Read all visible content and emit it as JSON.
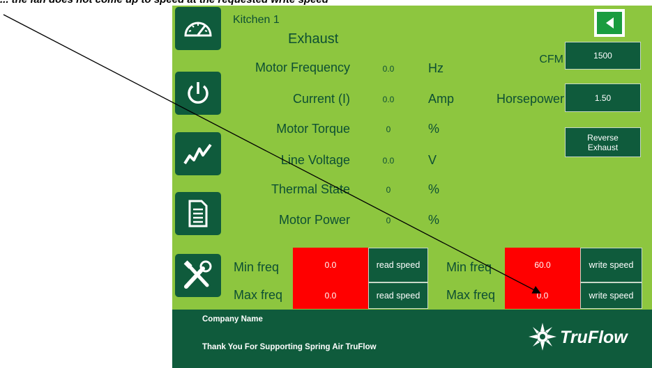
{
  "caption": "... the fan does not come up to speed at the requested write speed",
  "header": {
    "location": "Kitchen 1",
    "fan_type": "Exhaust"
  },
  "nav": [
    {
      "name": "dashboard",
      "icon": "speedometer-icon"
    },
    {
      "name": "power",
      "icon": "power-icon"
    },
    {
      "name": "trend",
      "icon": "trend-chart-icon"
    },
    {
      "name": "report",
      "icon": "document-icon"
    },
    {
      "name": "tools",
      "icon": "tools-icon"
    }
  ],
  "readings": [
    {
      "label": "Motor Frequency",
      "value": "0.0",
      "unit": "Hz"
    },
    {
      "label": "Current (I)",
      "value": "0.0",
      "unit": "Amp"
    },
    {
      "label": "Motor Torque",
      "value": "0",
      "unit": "%"
    },
    {
      "label": "Line Voltage",
      "value": "0.0",
      "unit": "V"
    },
    {
      "label": "Thermal State",
      "value": "0",
      "unit": "%"
    },
    {
      "label": "Motor Power",
      "value": "0",
      "unit": "%"
    }
  ],
  "right_panel": {
    "cfm_label": "CFM",
    "cfm_value": "1500",
    "hp_label": "Horsepower",
    "hp_value": "1.50",
    "reverse_line1": "Reverse",
    "reverse_line2": "Exhaust"
  },
  "freq": {
    "read": {
      "min_label": "Min freq",
      "min_value": "0.0",
      "max_label": "Max freq",
      "max_value": "0.0",
      "button": "read speed"
    },
    "write": {
      "min_label": "Min freq",
      "min_value": "60.0",
      "max_label": "Max freq",
      "max_value": "0.0",
      "button": "write speed"
    }
  },
  "footer": {
    "company": "Company Name",
    "thanks": "Thank You For Supporting Spring Air TruFlow",
    "brand": "TruFlow"
  },
  "colors": {
    "panel": "#8dc63f",
    "dark_green": "#0f5b3c",
    "text_green": "#0d4f33",
    "alert_red": "#ff0000"
  }
}
